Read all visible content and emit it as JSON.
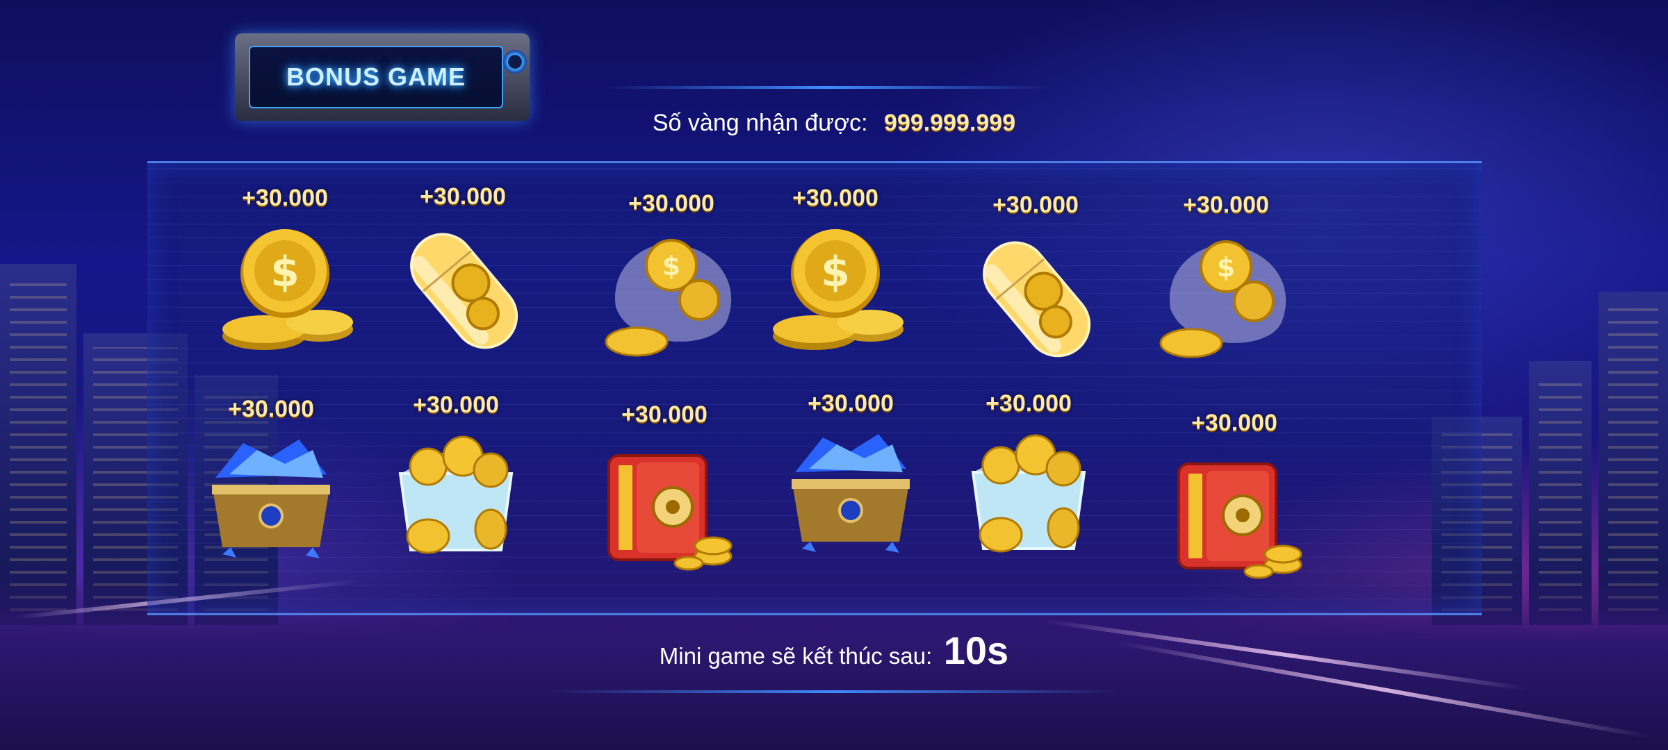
{
  "header": {
    "badge_title": "BONUS GAME"
  },
  "gold": {
    "label": "Số vàng nhận được:",
    "value": "999.999.999"
  },
  "rewards": [
    {
      "value": "+30.000",
      "icon": "gold-coin-stack-icon"
    },
    {
      "value": "+30.000",
      "icon": "coin-capsule-icon"
    },
    {
      "value": "+30.000",
      "icon": "coin-bag-icon"
    },
    {
      "value": "+30.000",
      "icon": "gold-coin-stack-icon"
    },
    {
      "value": "+30.000",
      "icon": "coin-capsule-icon"
    },
    {
      "value": "+30.000",
      "icon": "coin-bag-icon"
    },
    {
      "value": "+30.000",
      "icon": "gem-chest-icon"
    },
    {
      "value": "+30.000",
      "icon": "coin-crate-icon"
    },
    {
      "value": "+30.000",
      "icon": "red-safe-icon"
    },
    {
      "value": "+30.000",
      "icon": "gem-chest-icon"
    },
    {
      "value": "+30.000",
      "icon": "coin-crate-icon"
    },
    {
      "value": "+30.000",
      "icon": "red-safe-icon"
    }
  ],
  "timer": {
    "label": "Mini game sẽ kết thúc sau:",
    "value": "10s"
  },
  "colors": {
    "gold_text": "#ffe9a3",
    "accent_blue": "#3f8cff",
    "background": "#16168a"
  }
}
